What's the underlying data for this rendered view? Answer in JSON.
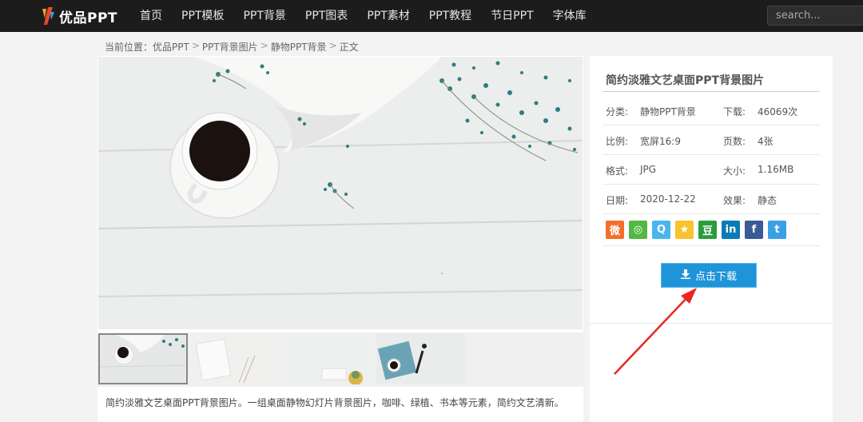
{
  "header": {
    "logo_text": "优品PPT",
    "nav": [
      "首页",
      "PPT模板",
      "PPT背景",
      "PPT图表",
      "PPT素材",
      "PPT教程",
      "节日PPT",
      "字体库"
    ],
    "search_placeholder": "search..."
  },
  "breadcrumb": {
    "items": [
      "当前位置：优品PPT",
      "PPT背景图片",
      "静物PPT背景",
      "正文"
    ],
    "separator": ">"
  },
  "detail": {
    "title": "简约淡雅文艺桌面PPT背景图片",
    "info": [
      {
        "label": "分类:",
        "value": "静物PPT背景",
        "label2": "下载:",
        "value2": "46069次"
      },
      {
        "label": "比例:",
        "value": "宽屏16:9",
        "label2": "页数:",
        "value2": "4张"
      },
      {
        "label": "格式:",
        "value": "JPG",
        "label2": "大小:",
        "value2": "1.16MB"
      },
      {
        "label": "日期:",
        "value": "2020-12-22",
        "label2": "效果:",
        "value2": "静态"
      }
    ],
    "share_icons": [
      {
        "name": "weibo-icon",
        "glyph": "微",
        "color": "#f26f2b"
      },
      {
        "name": "wechat-icon",
        "glyph": "◎",
        "color": "#52b843"
      },
      {
        "name": "qq-icon",
        "glyph": "Q",
        "color": "#4ab6ee"
      },
      {
        "name": "qzone-icon",
        "glyph": "★",
        "color": "#f8c230"
      },
      {
        "name": "douban-icon",
        "glyph": "豆",
        "color": "#2b9c3e"
      },
      {
        "name": "linkedin-icon",
        "glyph": "in",
        "color": "#0a7bb6"
      },
      {
        "name": "facebook-icon",
        "glyph": "f",
        "color": "#3b5a98"
      },
      {
        "name": "twitter-icon",
        "glyph": "t",
        "color": "#3aa0e6"
      }
    ],
    "download_label": "点击下载"
  },
  "description": "简约淡雅文艺桌面PPT背景图片。一组桌面静物幻灯片背景图片，咖啡、绿植、书本等元素，简约文艺清新。",
  "colors": {
    "topbar": "#1c1c1c",
    "download": "#1f94d8",
    "annotation_arrow": "#e8281e"
  }
}
